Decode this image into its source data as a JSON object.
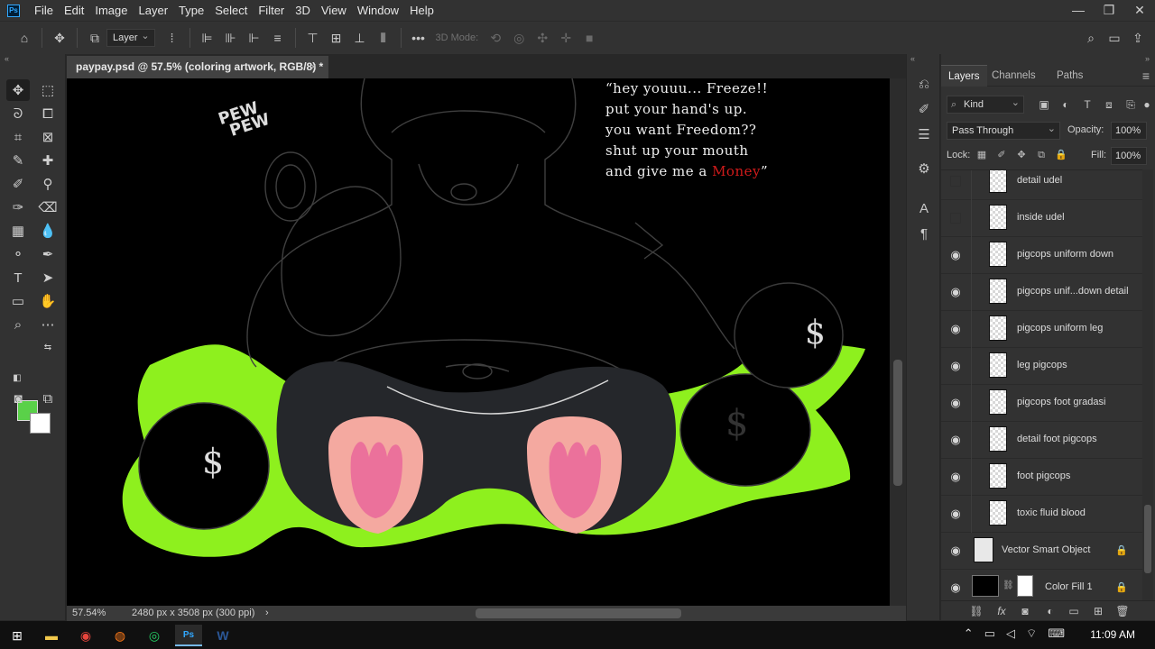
{
  "app": {
    "logo": "Ps"
  },
  "menu": [
    "File",
    "Edit",
    "Image",
    "Layer",
    "Type",
    "Select",
    "Filter",
    "3D",
    "View",
    "Window",
    "Help"
  ],
  "window_controls": {
    "minimize": "—",
    "restore": "❐",
    "close": "✕"
  },
  "options_bar": {
    "auto_select_target": "Layer",
    "mode_3d": "3D Mode:",
    "more": "•••"
  },
  "document": {
    "tab_title": "paypay.psd @ 57.5% (coloring artwork, RGB/8) *",
    "close": "×"
  },
  "artwork": {
    "pewpew_top": "PEW",
    "pewpew_bottom": "PEW",
    "quote_lines": [
      "“hey youuu... Freeze!!",
      "put your hand's up.",
      "you want Freedom??",
      "shut up your mouth"
    ],
    "quote_last_prefix": "and give me a ",
    "quote_money": "Money",
    "quote_last_suffix": "”",
    "dollar_sign": "$"
  },
  "status": {
    "zoom": "57.54%",
    "doc_size": "2480 px x 3508 px (300 ppi)",
    "arrow": "›"
  },
  "colors": {
    "foreground": "#5ad149",
    "background": "#ffffff",
    "toxic_green": "#8ef01e",
    "money_red": "#d21b1b"
  },
  "layers_panel": {
    "tabs": [
      "Layers",
      "Channels",
      "Paths"
    ],
    "kind_filter": "Kind",
    "blend_mode": "Pass Through",
    "opacity_label": "Opacity:",
    "opacity": "100%",
    "lock_label": "Lock:",
    "fill_label": "Fill:",
    "fill": "100%",
    "layers": [
      {
        "name": "detail udel",
        "visible": false
      },
      {
        "name": "inside udel",
        "visible": false
      },
      {
        "name": "pigcops uniform down",
        "visible": true
      },
      {
        "name": "pigcops unif...down detail",
        "visible": true
      },
      {
        "name": "pigcops uniform leg",
        "visible": true
      },
      {
        "name": "leg pigcops",
        "visible": true
      },
      {
        "name": "pigcops foot gradasi",
        "visible": true
      },
      {
        "name": "detail foot pigcops",
        "visible": true
      },
      {
        "name": "foot pigcops",
        "visible": true
      },
      {
        "name": "toxic fluid blood",
        "visible": true
      },
      {
        "name": "Vector Smart Object",
        "visible": true,
        "locked": true
      },
      {
        "name": "Color Fill 1",
        "visible": true,
        "locked": true
      }
    ]
  },
  "taskbar": {
    "time": "11:09 AM"
  }
}
